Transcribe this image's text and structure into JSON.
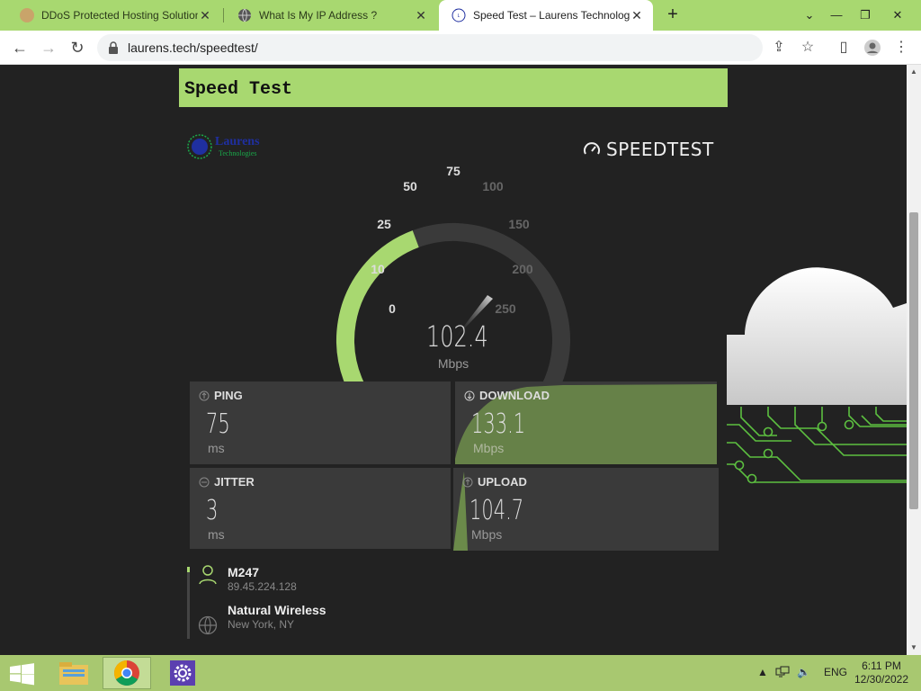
{
  "browser": {
    "tabs": [
      {
        "title": "DDoS Protected Hosting Solution",
        "favicon": "hosting-icon",
        "active": false
      },
      {
        "title": "What Is My IP Address ?",
        "favicon": "globe-icon",
        "active": false
      },
      {
        "title": "Speed Test – Laurens Technologie",
        "favicon": "laurens-icon",
        "active": true
      }
    ],
    "address": "laurens.tech/speedtest/"
  },
  "page": {
    "title": "Speed Test",
    "logo": {
      "name": "Laurens",
      "tagline": "Technologies"
    },
    "brand": "SPEEDTEST",
    "gauge": {
      "ticks": [
        "0",
        "10",
        "25",
        "50",
        "75",
        "100",
        "150",
        "200",
        "250"
      ],
      "value": "102.4",
      "unit": "Mbps"
    },
    "metrics": {
      "ping": {
        "label": "PING",
        "value": "75",
        "unit": "ms"
      },
      "download": {
        "label": "DOWNLOAD",
        "value": "133.1",
        "unit": "Mbps"
      },
      "jitter": {
        "label": "JITTER",
        "value": "3",
        "unit": "ms"
      },
      "upload": {
        "label": "UPLOAD",
        "value": "104.7",
        "unit": "Mbps"
      }
    },
    "provider": {
      "name": "M247",
      "ip": "89.45.224.128"
    },
    "server": {
      "name": "Natural Wireless",
      "location": "New York, NY"
    }
  },
  "colors": {
    "accent": "#a8d870",
    "panel": "#3a3a3a",
    "background": "#222222"
  },
  "taskbar": {
    "language": "ENG",
    "time": "6:11 PM",
    "date": "12/30/2022"
  }
}
